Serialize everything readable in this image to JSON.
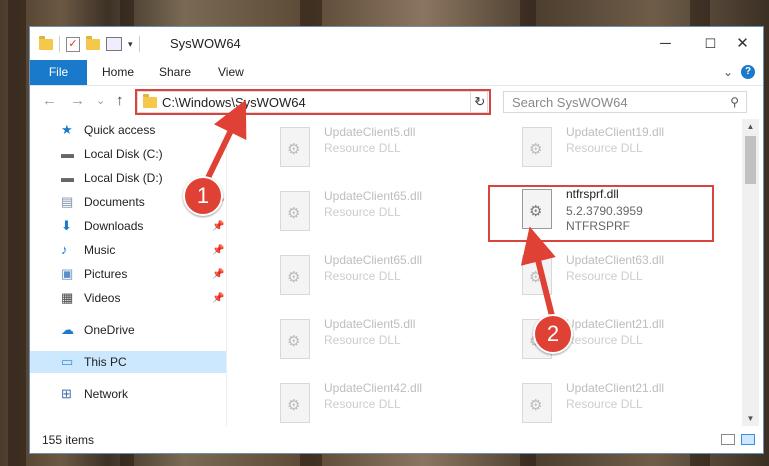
{
  "window": {
    "title": "SysWOW64",
    "minimize_glyph": "─",
    "maximize_glyph": "☐",
    "close_glyph": "✕"
  },
  "quick_access_toolbar": {
    "dropdown_glyph": "▾"
  },
  "ribbon": {
    "tabs": [
      "File",
      "Home",
      "Share",
      "View"
    ],
    "expand_glyph": "⌄",
    "help_glyph": "?"
  },
  "navigation": {
    "back_glyph": "←",
    "forward_glyph": "→",
    "recent_glyph": "⌄",
    "up_glyph": "↑",
    "address_path": "C:\\Windows\\SysWOW64",
    "address_dropdown_glyph": "⌄",
    "refresh_glyph": "↻",
    "search_placeholder": "Search SysWOW64",
    "search_glyph": "⚲"
  },
  "sidebar": {
    "items": [
      {
        "label": "Quick access",
        "icon": "star-icon",
        "pinned": false
      },
      {
        "label": "Local Disk (C:)",
        "icon": "drive-icon",
        "pinned": false
      },
      {
        "label": "Local Disk (D:)",
        "icon": "drive-icon",
        "pinned": false
      },
      {
        "label": "Documents",
        "icon": "documents-icon",
        "pinned": true
      },
      {
        "label": "Downloads",
        "icon": "download-icon",
        "pinned": true
      },
      {
        "label": "Music",
        "icon": "music-icon",
        "pinned": true
      },
      {
        "label": "Pictures",
        "icon": "pictures-icon",
        "pinned": true
      },
      {
        "label": "Videos",
        "icon": "videos-icon",
        "pinned": true
      },
      {
        "label": "OneDrive",
        "icon": "cloud-icon",
        "pinned": false
      },
      {
        "label": "This PC",
        "icon": "pc-icon",
        "pinned": false,
        "selected": true
      },
      {
        "label": "Network",
        "icon": "network-icon",
        "pinned": false
      }
    ],
    "pin_glyph": "📌"
  },
  "files": [
    {
      "name": "UpdateClient5.dll",
      "type": "Resource DLL"
    },
    {
      "name": "UpdateClient19.dll",
      "type": "Resource DLL"
    },
    {
      "name": "UpdateClient65.dll",
      "type": "Resource DLL"
    },
    {
      "name": "ntfrsprf.dll",
      "version": "5.2.3790.3959",
      "description": "NTFRSPRF",
      "highlighted": true
    },
    {
      "name": "UpdateClient65.dll",
      "type": "Resource DLL"
    },
    {
      "name": "UpdateClient63.dll",
      "type": "Resource DLL"
    },
    {
      "name": "UpdateClient5.dll",
      "type": "Resource DLL"
    },
    {
      "name": "UpdateClient21.dll",
      "type": "Resource DLL"
    },
    {
      "name": "UpdateClient42.dll",
      "type": "Resource DLL"
    },
    {
      "name": "UpdateClient21.dll",
      "type": "Resource DLL"
    }
  ],
  "status": {
    "item_count": "155 items"
  },
  "annotations": {
    "callout_1": "1",
    "callout_2": "2",
    "highlight_color": "#d9453a"
  },
  "colors": {
    "accent": "#1979ca",
    "selection": "#cce8ff"
  }
}
